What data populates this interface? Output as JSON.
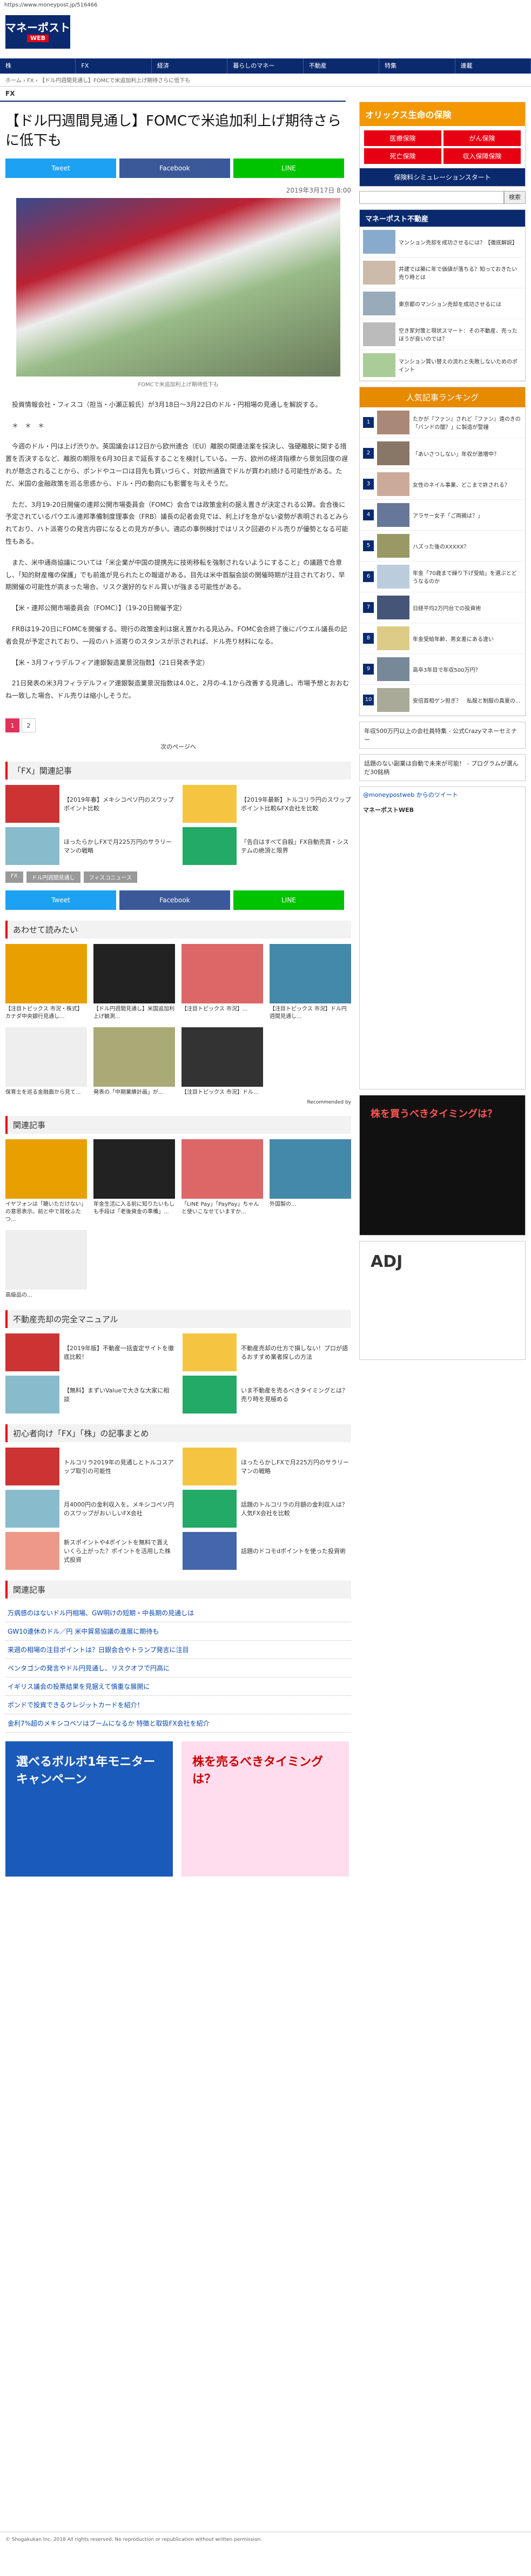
{
  "url": "https://www.moneypost.jp/516466",
  "logo": {
    "main": "マネーポスト",
    "sub": "WEB"
  },
  "nav": [
    "株",
    "FX",
    "経済",
    "暮らしのマネー",
    "不動産",
    "特集",
    "連載"
  ],
  "breadcrumb": "ホーム › FX › 【ドル円週間見通し】FOMCで米追加利上げ期待さらに低下も",
  "category": "FX",
  "article": {
    "title": "【ドル円週間見通し】FOMCで米追加利上げ期待さらに低下も",
    "share": {
      "twitter": "Tweet",
      "facebook": "Facebook",
      "line": "LINE"
    },
    "date": "2019年3月17日 8:00",
    "caption": "FOMCで米追加利上げ期待低下も",
    "paragraphs": [
      "投資情報会社・フィスコ（担当・小瀬正毅氏）が3月18日〜3月22日のドル・円相場の見通しを解説する。",
      "＊　＊　＊",
      "今週のドル・円は上げ渋りか。英国議会は12日から欧州連合（EU）離脱の関連法案を採決し、強硬離脱に関する措置を否決するなど、離脱の期限を6月30日まで延長することを検討している。一方、欧州の経済指標から景気回復の遅れが懸念されることから、ポンドやユーロは目先も買いづらく、対欧州通貨でドルが買われ続ける可能性がある。ただ、米国の金融政策を巡る思惑から、ドル・円の動向にも影響を与えそうだ。",
      "ただ、3月19-20日開催の連邦公開市場委員会（FOMC）会合では政策金利の据え置きが決定される公算。会合後に予定されているパウエル連邦準備制度理事会（FRB）議長の記者会見では、利上げを急がない姿勢が表明されるとみられており、ハト派寄りの発言内容になるとの見方が多い。適応の事例検討ではリスク回避のドル売りが優勢となる可能性もある。",
      "また、米中通商協議については「米企業が中国の提携先に技術移転を強制されないようにすること」の議題で合意し、「知的財産権の保護」でも前進が見られたとの報道がある。目先は米中首脳会談の開催時期が注目されており、早期開催の可能性が高まった場合、リスク選好的なドル買いが強まる可能性がある。"
    ],
    "schedule": [
      "【米・連邦公開市場委員会（FOMC）】（19-20日開催予定）",
      "FRBは19-20日にFOMCを開催する。現行の政策金利は据え置かれる見込み。FOMC会合終了後にパウエル議長の記者会見が予定されており、一段のハト派寄りのスタンスが示されれば、ドル売り材料になる。",
      "【米・3月フィラデルフィア連銀製造業景況指数】（21日発表予定）",
      "21日発表の米3月フィラデルフィア連銀製造業景況指数は4.0と、2月の-4.1から改善する見通し。市場予想とおおむね一致した場合、ドル売りは縮小しそうだ。"
    ],
    "pages": [
      "1",
      "2"
    ],
    "next": "次のページへ"
  },
  "related_fx": {
    "title": "「FX」関連記事",
    "items": [
      "【2019年春】メキシコペソ円のスワップポイント比較",
      "【2019年最新】トルコリラ円のスワップポイント比較&FX会社を比較",
      "ほったらかしFXで月225万円のサラリーマンの戦略",
      "「告白はすべて自殺」FX自動売買・システムの絶頂と限界"
    ],
    "tags": [
      "FX",
      "ドル円週間見通し",
      "フィスコニュース"
    ]
  },
  "recommend": {
    "title": "あわせて読みたい",
    "items": [
      "【注目トピックス 市況・株式】カナダ中央銀行見通し...",
      "【ドル円週間見通し】米国追加利上げ観測...",
      "【注目トピックス 市況】...",
      "【注目トピックス 市況】ドル円週間見通し...",
      "保育士を巡る金融面から見て...",
      "発表の「中期業績計画」が...",
      "【注目トピックス 市況】ドル..."
    ],
    "by": "Recommended by"
  },
  "recommend2": {
    "title": "関連記事",
    "items": [
      "イヤフォンは「聴いただけない」の意思表示。前と中で耳栓ふたつ...",
      "年金生活に入る前に知りたいもしも手段は「老後資金の準備」...",
      "「LINE Pay」「PayPay」ちゃんと使いこなせていますか...",
      "外国製の...",
      "高級品の..."
    ]
  },
  "realestate": {
    "title": "不動産売却の完全マニュアル",
    "items": [
      "【2019年版】不動産一括査定サイトを徹底比較！",
      "不動産売却の仕方で損しない！プロが語るおすすめ業者探しの方法",
      "【無料】まずいValueで大きな大家に相談",
      "いま不動産を売るべきタイミングとは？売り時を見極める"
    ]
  },
  "beginner": {
    "title": "初心者向け「FX」「株」の記事まとめ",
    "items": [
      "トルコリラ2019年の見通しとトルコスアップ取引の可能性",
      "ほったらかしFXで月225万円のサラリーマンの戦略",
      "月4000円の金利収入を。メキシコペソ円のスワップがおいしいFX会社",
      "話題のトルコリラの月額の金利収入は？人気FX会社を比較",
      "新スポイントや4ポイントを無料で貰えいくら上がった？ポイントを活用した株式投資",
      "話題のドコモdポイントを使った投資術"
    ]
  },
  "related_list": {
    "title": "関連記事",
    "items": [
      "万病感のはないドル円相場、GW明けの短期・中長期の見通しは",
      "GW10連休のドル／円 米中貿易協議の進展に期待も",
      "来週の相場の注目ポイントは？日銀会合やトランプ発言に注目",
      "ペンタゴンの発言やドル円見通し、リスクオフで円高に",
      "イギリス議会の投票結果を見据えて慎重な展開に",
      "ポンドで投資できるクレジットカードを紹介！",
      "金利7%超のメキシコペソはブームになるか 特徴と取扱FX会社を紹介"
    ]
  },
  "sidebar": {
    "ad_title": "オリックス生命の保険",
    "ad_items": [
      "医療保険",
      "がん保険",
      "死亡保険",
      "収入保障保険"
    ],
    "ad_footer": "保険料シミュレーションスタート",
    "search_btn": "検索",
    "realestate_head": "マネーポスト不動産",
    "realestate_items": [
      "マンション売却を成功させるには？【徹底解説】",
      "井建では築に年で価値が落ちる？知っておきたい売り時とは",
      "東京都のマンション売却を成功させるには",
      "空き家対策と現状スマート：その不動産、売ったほうが良いのでは？",
      "マンション買い替えの流れと失敗しないためのポイント"
    ],
    "ranking_head": "人気記事ランキング",
    "ranking": [
      "たかが『ファン』されど『ファン』遠のきの「バンドの闇？」に製造が警鐘",
      "「あいさつしない」年収が激増中？",
      "女性のネイル事業、どこまで許される？",
      "アラサー女子「ご両親は？」",
      "ハズった後のXXXXX？",
      "年金「70歳まで繰り下げ受給」を選ぶとどうなるのか",
      "日経平均2万円台での投資術",
      "年金受給年齢、男女差にある違い",
      "高卒3年目で年収500万円？",
      "安倍首相ゲン担ぎ？　私服と制服の真夏の..."
    ],
    "campaign": "年収500万円以上の会社員特集 - 公式Crazyマネーセミナー",
    "campaign2": "話題のない副業は自動で未来が可能！ - プログラムが選んだ30銘柄",
    "twitter_head": "@moneypostweb からのツイート",
    "twitter_name": "マネーポストWEB",
    "ad2_title": "株を買うべきタイミングは？",
    "ad3_title": "ADJ",
    "ad4_title": "株を買うべきタイミングは？"
  },
  "bottom_ad": {
    "left": "選べるボルボ1年モニターキャンペーン",
    "right": "株を売るべきタイミングは？"
  },
  "footer": "© Shogakukan Inc. 2018 All rights reserved. No reproduction or republication without written permission."
}
